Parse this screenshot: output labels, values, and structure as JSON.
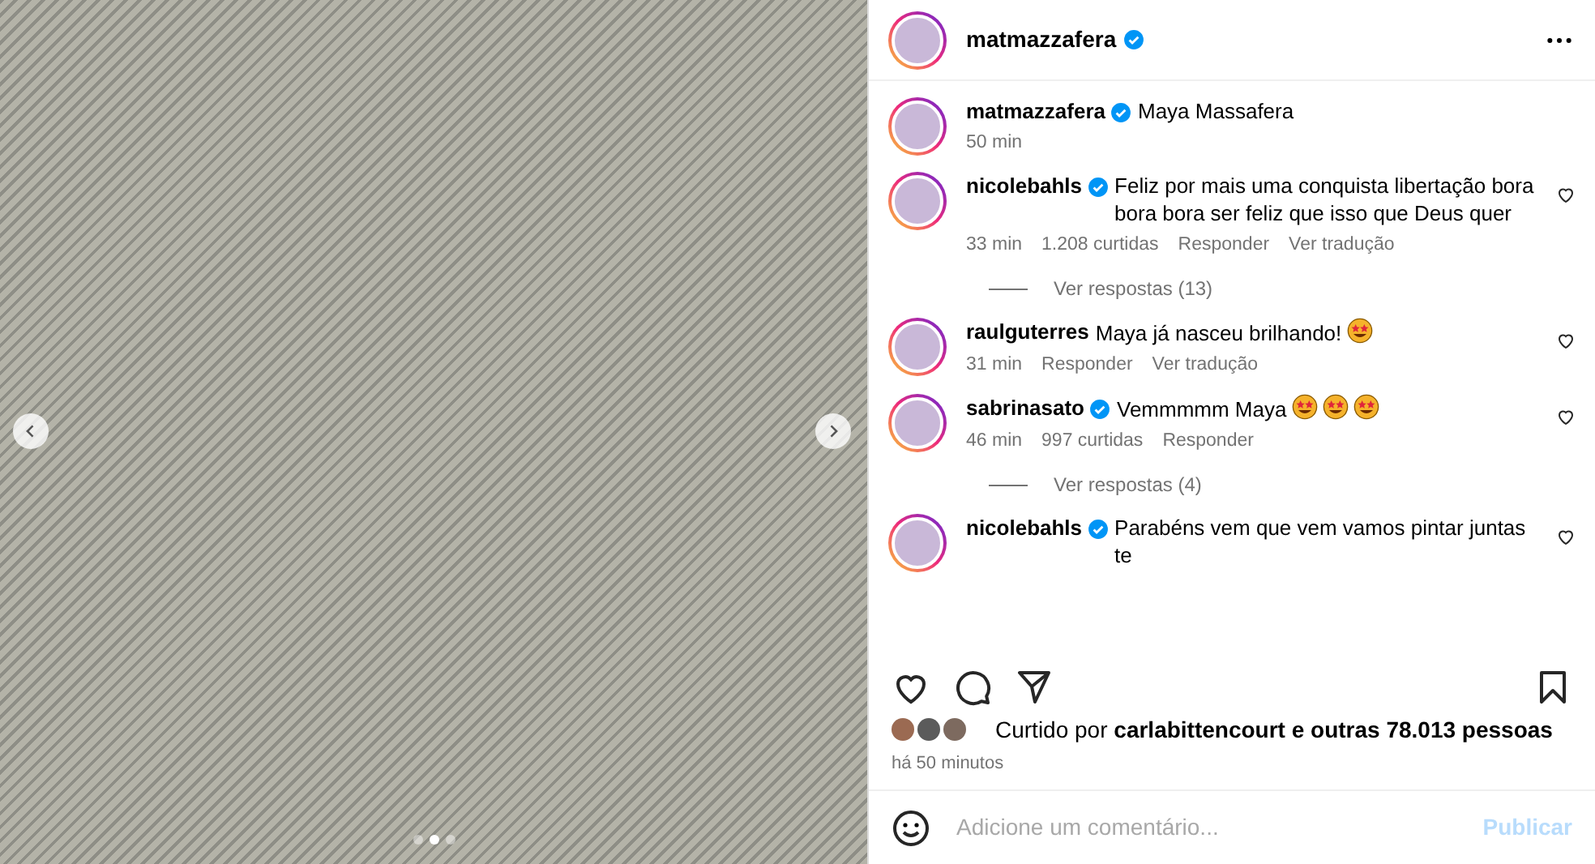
{
  "photo": {
    "dots": [
      {
        "selected": false
      },
      {
        "selected": true
      },
      {
        "selected": false
      }
    ]
  },
  "header": {
    "username": "matmazzafera",
    "verified": true
  },
  "caption": {
    "username": "matmazzafera",
    "verified": true,
    "text": "Maya Massafera",
    "time": "50 min"
  },
  "comments": [
    {
      "username": "nicolebahls",
      "verified": true,
      "text": "Feliz por mais uma conquista libertação bora bora bora ser feliz que isso que Deus quer",
      "time": "33 min",
      "likes": "1.208 curtidas",
      "actions": [
        "Responder",
        "Ver tradução"
      ],
      "replies": "Ver respostas (13)"
    },
    {
      "username": "raulguterres",
      "text": "Maya já nasceu brilhando!",
      "emoji": [
        {
          "kind": "star-struck"
        }
      ],
      "time": "31 min",
      "actions": [
        "Responder",
        "Ver tradução"
      ]
    },
    {
      "username": "sabrinasato",
      "verified": true,
      "text": "Vemmmmm Maya",
      "emoji": [
        {
          "kind": "star-struck"
        },
        {
          "kind": "star-struck"
        },
        {
          "kind": "star-struck"
        }
      ],
      "time": "46 min",
      "likes": "997 curtidas",
      "actions": [
        "Responder"
      ],
      "replies": "Ver respostas (4)"
    },
    {
      "username": "nicolebahls",
      "verified": true,
      "text": "Parabéns vem que vem vamos pintar juntas te"
    }
  ],
  "likes": {
    "prefix": "Curtido por",
    "user": "carlabittencourt",
    "rest": "e outras 78.013 pessoas",
    "time": "há 50 minutos"
  },
  "composer": {
    "placeholder": "Adicione um comentário...",
    "button": "Publicar",
    "disabled": true
  }
}
